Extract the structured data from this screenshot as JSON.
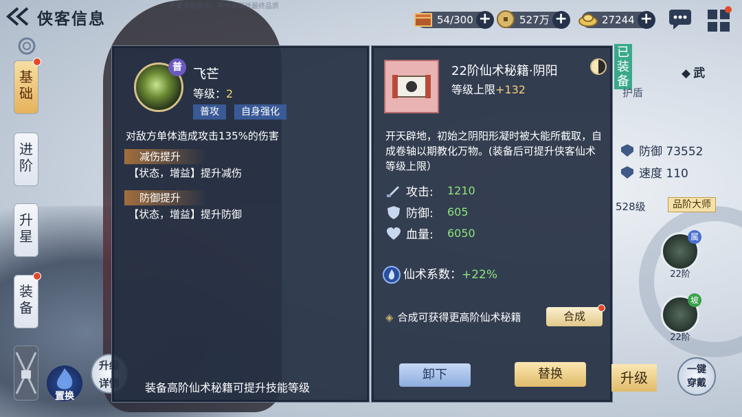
{
  "header": {
    "title": "侠客信息",
    "version_note": "先遣体验版本，不代表游戏最终品质"
  },
  "resources": [
    {
      "name": "chest",
      "value": "54/300"
    },
    {
      "name": "coin",
      "value": "527万"
    },
    {
      "name": "gold-ingot",
      "value": "27244"
    }
  ],
  "tabs": {
    "basic": "基础",
    "advance": "进阶",
    "star": "升星",
    "equip": "装备"
  },
  "bottom_left": {
    "swap_label": "置换",
    "detail_label_1": "升级",
    "detail_label_2": "详情"
  },
  "skill": {
    "grade": "普",
    "name": "飞芒",
    "level_label": "等级：",
    "level_value": "2",
    "tag_1": "普攻",
    "tag_2": "自身强化",
    "description": "对敌方单体造成攻击135%的伤害",
    "effect_1_title": "减伤提升",
    "effect_1_body": "【状态，增益】提升减伤",
    "effect_2_title": "防御提升",
    "effect_2_body": "【状态，增益】提升防御",
    "footer": "装备高阶仙术秘籍可提升技能等级"
  },
  "item": {
    "title": "22阶仙术秘籍·阴阳",
    "limit_label": "等级上限",
    "limit_value": "+132",
    "description": "开天辟地，初始之阴阳形凝时被大能所截取，自成卷轴以期教化万物。(装备后可提升侠客仙术等级上限）",
    "stats": [
      {
        "label": "攻击:",
        "value": "1210",
        "icon": "sword-icon"
      },
      {
        "label": "防御:",
        "value": "605",
        "icon": "shield-icon"
      },
      {
        "label": "血量:",
        "value": "6050",
        "icon": "heart-icon"
      }
    ],
    "coef_label": "仙术系数：",
    "coef_value": "+22%",
    "synth_hint": "合成可获得更高阶仙术秘籍",
    "synth_button": "合成",
    "unequip_button": "卸下",
    "replace_button": "替换",
    "equipped_tag": "已装备"
  },
  "right_side": {
    "wu_label": "武",
    "hudun_label": "护盾",
    "defense_label": "防御",
    "defense_value": "73552",
    "speed_label": "速度",
    "speed_value": "110",
    "level_text": "528级",
    "master_badge": "品阶大师",
    "slot_1_attr": "属",
    "slot_1_level": "22阶",
    "slot_2_attr": "坡",
    "slot_2_level": "22阶",
    "upgrade_button": "升级",
    "onekey_button_1": "一键",
    "onekey_button_2": "穿戴"
  }
}
